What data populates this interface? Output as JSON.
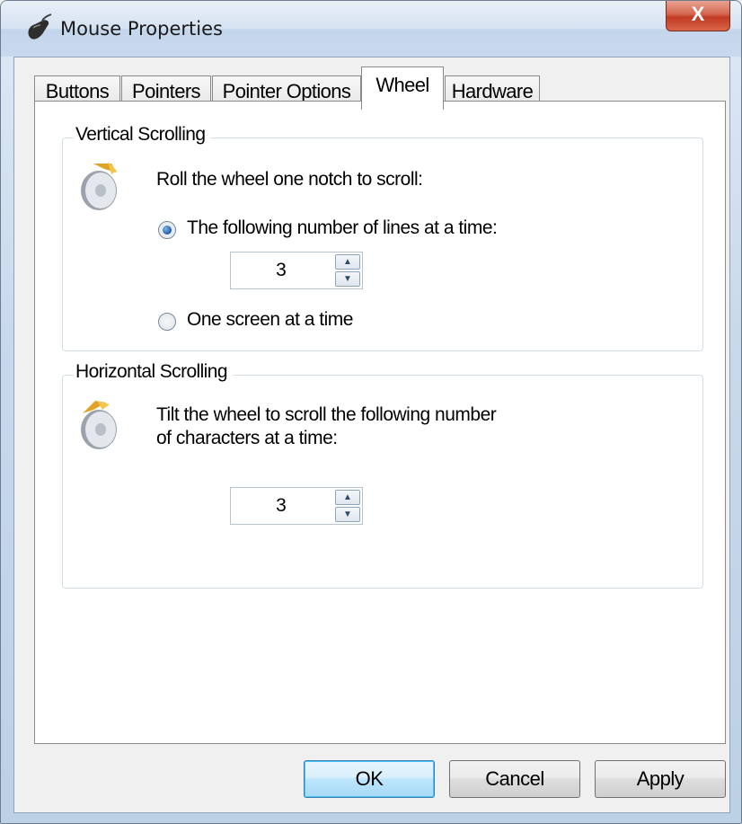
{
  "window": {
    "title": "Mouse Properties",
    "close_label": "X",
    "title_icon": "mouse-icon"
  },
  "tabs": [
    {
      "label": "Buttons",
      "active": false
    },
    {
      "label": "Pointers",
      "active": false
    },
    {
      "label": "Pointer Options",
      "active": false
    },
    {
      "label": "Wheel",
      "active": true
    },
    {
      "label": "Hardware",
      "active": false
    }
  ],
  "vertical": {
    "group_title": "Vertical Scrolling",
    "icon": "wheel-vertical-icon",
    "prompt": "Roll the wheel one notch to scroll:",
    "option_lines": "The following number of lines at a time:",
    "option_lines_selected": true,
    "lines_value": "3",
    "option_screen": "One screen at a time",
    "option_screen_selected": false
  },
  "horizontal": {
    "group_title": "Horizontal Scrolling",
    "icon": "wheel-horizontal-icon",
    "prompt_line1": "Tilt the wheel to scroll the following number",
    "prompt_line2": "of characters at a time:",
    "chars_value": "3"
  },
  "buttons": {
    "ok": "OK",
    "cancel": "Cancel",
    "apply": "Apply"
  },
  "colors": {
    "accent": "#3c7fb1",
    "close": "#c23b22"
  }
}
